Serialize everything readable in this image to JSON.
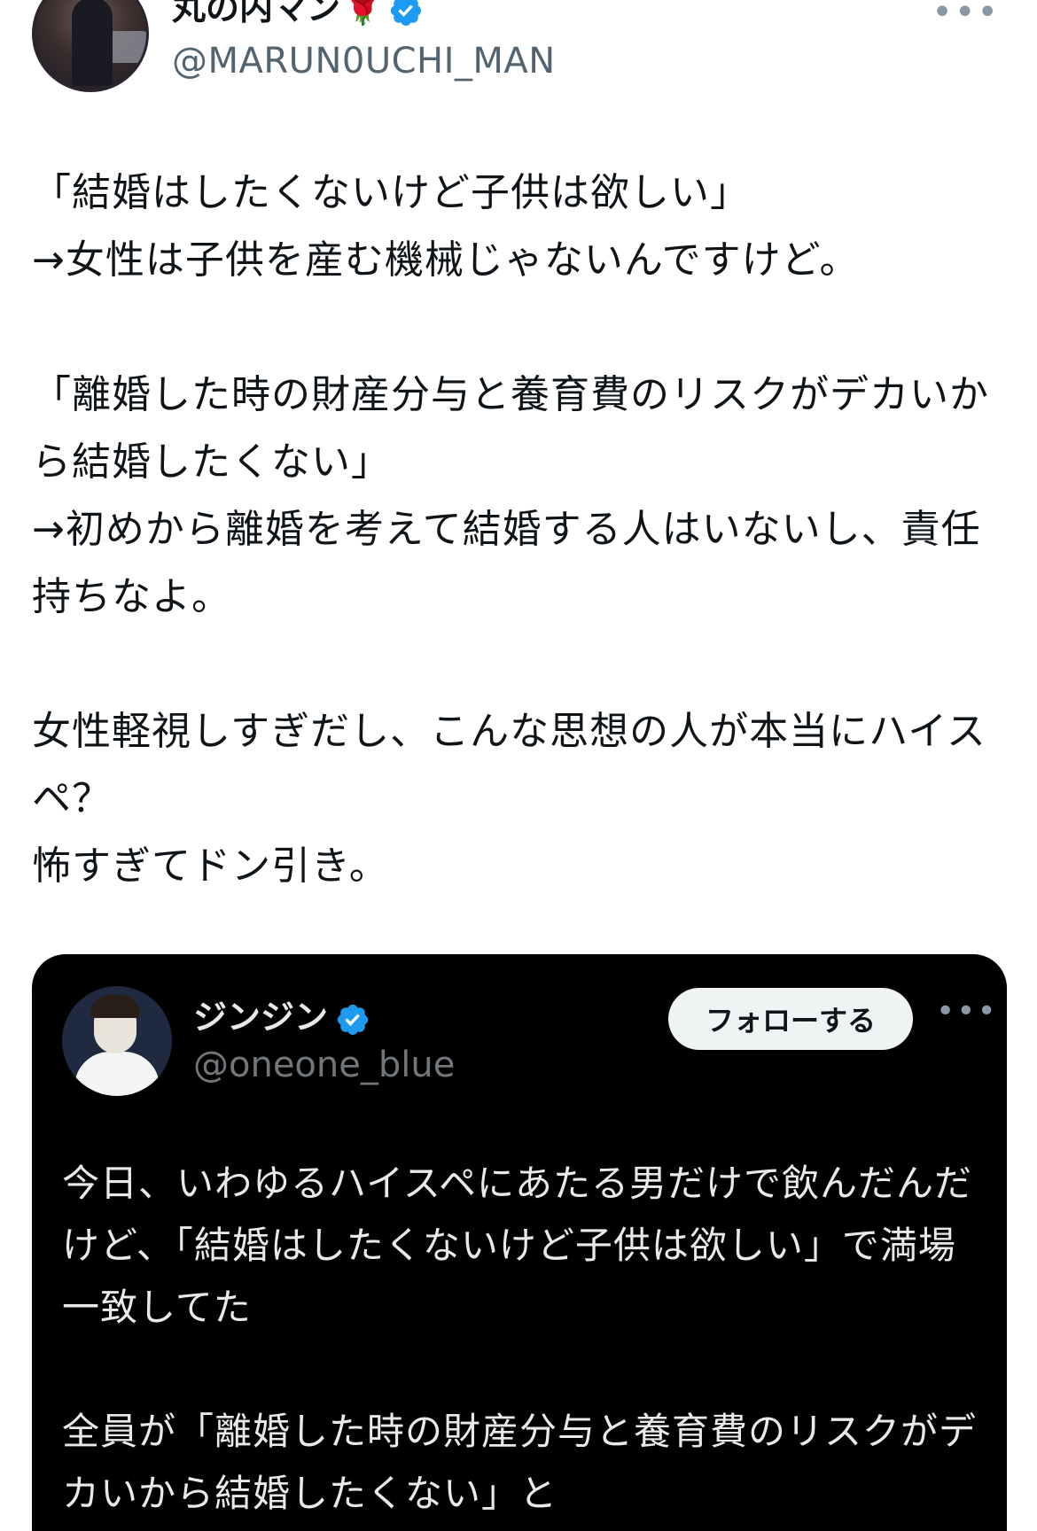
{
  "post": {
    "author_name": "丸の内マン",
    "author_emoji": "🌹",
    "handle": "@MARUN0UCHI_MAN",
    "more_label": "•••",
    "paragraphs": [
      "「結婚はしたくないけど子供は欲しい」\n→女性は子供を産む機械じゃないんですけど。",
      "「離婚した時の財産分与と養育費のリスクがデカいから結婚したくない」\n→初めから離婚を考えて結婚する人はいないし、責任持ちなよ。",
      "女性軽視しすぎだし、こんな思想の人が本当にハイスペ？\n怖すぎてドン引き。"
    ]
  },
  "quote": {
    "author_name": "ジンジン",
    "handle": "@oneone_blue",
    "follow_label": "フォローする",
    "more_label": "•••",
    "paragraphs": [
      "今日、いわゆるハイスペにあたる男だけで飲んだんだけど、「結婚はしたくないけど子供は欲しい」で満場一致してた",
      "全員が「離婚した時の財産分与と養育費のリスクがデカいから結婚したくない」と"
    ]
  },
  "colors": {
    "verified": "#1d9bf0",
    "quote_bg": "#000000",
    "handle_gray": "#536471"
  }
}
